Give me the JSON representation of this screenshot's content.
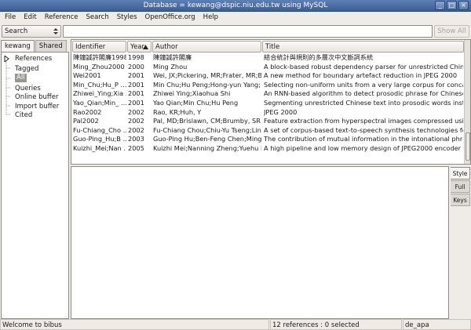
{
  "window": {
    "title": "Database = kewang@dspic.niu.edu.tw using MySQL",
    "minimize": "_",
    "maximize": "□",
    "close": "×"
  },
  "menu": [
    "File",
    "Edit",
    "Reference",
    "Search",
    "Styles",
    "OpenOffice.org",
    "Help"
  ],
  "toolbar": {
    "search_mode": "Search",
    "search_value": "",
    "show_all_label": "Show All"
  },
  "tabs": [
    "kewang",
    "Shared"
  ],
  "tree": {
    "root": "References",
    "children": [
      "Tagged",
      "All",
      "Queries",
      "Online buffer",
      "Import buffer",
      "Cited"
    ],
    "selected": "All"
  },
  "table": {
    "columns": [
      "Identifier",
      "Year",
      "Author",
      "Title"
    ],
    "sorted_column": "Year",
    "rows": [
      [
        "陳鐘誠許閣廉1998",
        "1998",
        "陳鐘誠許閣廉",
        "結合統計與規則的多層次中文斷詞系統"
      ],
      [
        "Ming_Zhou2000",
        "2000",
        "Ming Zhou",
        "A block-based robust dependency parser for unrestricted Chinese"
      ],
      [
        "Wei2001",
        "2001",
        "Wei, JX;Pickering, MR;Frater, MR;B …",
        "A new method for boundary artefact reduction in JPEG 2000"
      ],
      [
        "Min_Chu;Hu_P …",
        "2001",
        "Min Chu;Hu Peng;Hong-yun Yang; …",
        "Selecting non-uniform units from a very large corpus for concaten"
      ],
      [
        "Zhiwei_Ying;Xia …",
        "2001",
        "Zhiwei Ying;Xiaohua Shi",
        "An RNN-based algorithm to detect prosodic phrase for Chinese TTS"
      ],
      [
        "Yao_Qian;Min_ …",
        "2001",
        "Yao Qian;Min Chu;Hu Peng",
        "Segmenting unrestricted Chinese text into prosodic words instea …"
      ],
      [
        "Rao2002",
        "2002",
        "Rao, KR;Huh, Y",
        "JPEG 2000"
      ],
      [
        "Pal2002",
        "2002",
        "Pal, MD;Brislawn, CM;Brumby, SR",
        "Feature extraction from hyperspectral images compressed using"
      ],
      [
        "Fu-Chiang_Cho …",
        "2002",
        "Fu-Chiang Chou;Chiu-Yu Tseng;Lin- …",
        "A set of corpus-based text-to-speech synthesis technologies for"
      ],
      [
        "Guo-Ping_Hu;B …",
        "2003",
        "Guo-Ping Hu;Ben-Feng Chen;Ming …",
        "The contribution of mutual information in the intonational phrase"
      ],
      [
        "Kuizhi_Mei;Nan …",
        "2005",
        "Kuizhi Mei;Nanning Zheng;Yuehu Liu",
        "A high pipeline and low memory design of JPEG2000 encoder"
      ]
    ]
  },
  "side_tabs": [
    "Style",
    "Full",
    "Keys"
  ],
  "status": {
    "message": "Welcome to bibus",
    "count": "12 references : 0 selected",
    "style": "de_apa"
  }
}
